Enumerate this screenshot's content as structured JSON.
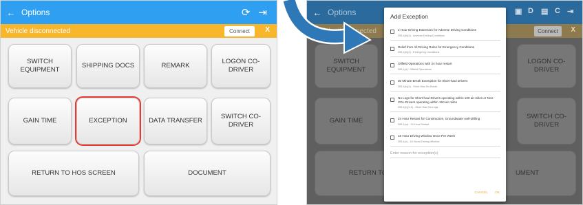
{
  "colors": {
    "appbar": "#2f9ff1",
    "status": "#f7b62b",
    "highlight": "#e53935",
    "arrow": "#2e78b8",
    "dialog_action": "#f0a73a"
  },
  "left": {
    "appbar": {
      "back_icon": "arrow-left-icon",
      "title": "Options",
      "sync_icon": "sync-icon",
      "logout_icon": "logout-icon"
    },
    "status": {
      "text": "Vehicle disconnected",
      "connect": "Connect",
      "close": "X"
    },
    "tiles": [
      "SWITCH EQUIPMENT",
      "SHIPPING DOCS",
      "REMARK",
      "LOGON CO-DRIVER",
      "GAIN TIME",
      "EXCEPTION",
      "DATA TRANSFER",
      "SWITCH CO-DRIVER",
      "RETURN TO HOS SCREEN",
      "DOCUMENT"
    ]
  },
  "right": {
    "appbar": {
      "title": "Options",
      "icons": [
        "monitor-icon",
        "D",
        "truck-icon",
        "C",
        "logout-icon"
      ]
    },
    "status": {
      "text": "Vehicle disconnected",
      "connect": "Connect",
      "close": "X"
    },
    "bg_tiles": {
      "switch_equipment": "SWITCH EQUIPMENT",
      "logon_co_driver": "LOGON CO-DRIVER",
      "gain_time": "GAIN TIME",
      "switch_co_driver": "SWITCH CO-DRIVER",
      "return": "RETURN TO H",
      "document": "UMENT"
    },
    "dialog": {
      "title": "Add Exception",
      "options": [
        {
          "label": "2 Hour Driving Extension for Adverse Driving Conditions",
          "sub": "395.1(b)(1) - Adverse Driving Conditions"
        },
        {
          "label": "Relief from All Driving Rules for Emergency Conditions",
          "sub": "395.1(b)(2) - Emergency Conditions"
        },
        {
          "label": "Oilfield Operations with 24 hour restart",
          "sub": "395.1(d) - Oilfield Operations"
        },
        {
          "label": "30 Minute Break Exemption for Short-haul Drivers",
          "sub": "395.1(e)(1) - Short Haul No Break"
        },
        {
          "label": "No Logs for Short-haul Drivers operating within 100 air-miles or Non-CDL-Drivers operating within 150 air miles",
          "sub": "395.1(e)(1,2) - Short Haul No Logs"
        },
        {
          "label": "24 Hour Restart for Construction, Groundwater well-drilling",
          "sub": "395.1(m) - 24 Hour Restart"
        },
        {
          "label": "16 Hour Driving Window Once Per Week",
          "sub": "395.1(o) - 16 Hours Driving Window"
        }
      ],
      "reason_placeholder": "Enter reason for exception(s)",
      "cancel": "CANCEL",
      "ok": "OK"
    }
  }
}
